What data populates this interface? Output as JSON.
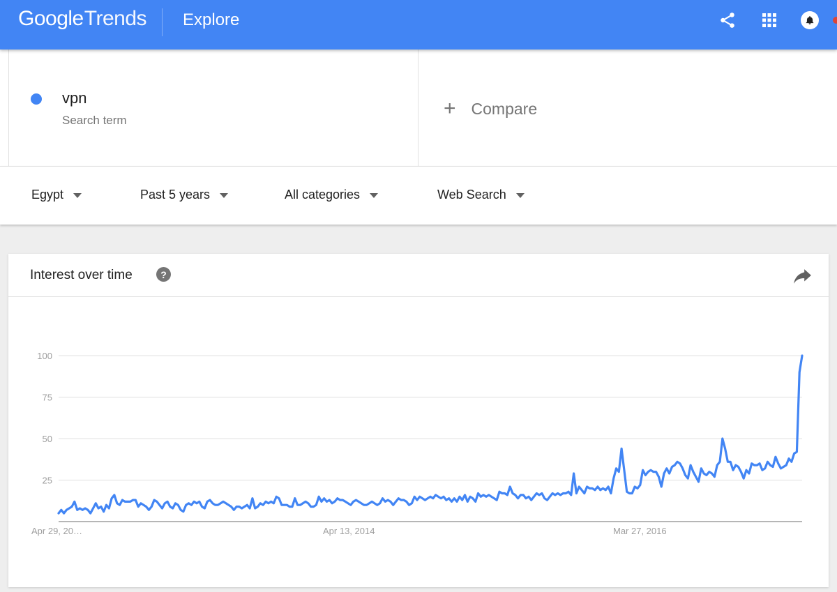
{
  "header": {
    "logo_google": "Google",
    "logo_trends": "Trends",
    "section": "Explore",
    "icons": [
      "share-icon",
      "apps-grid-icon",
      "notifications-icon"
    ],
    "brand_color": "#4285f4"
  },
  "term": {
    "name": "vpn",
    "subtitle": "Search term",
    "color": "#4285f4"
  },
  "compare": {
    "plus": "+",
    "label": "Compare"
  },
  "filters": {
    "region": "Egypt",
    "time": "Past 5 years",
    "category": "All categories",
    "property": "Web Search"
  },
  "card": {
    "title": "Interest over time",
    "help": "?"
  },
  "chart_data": {
    "type": "line",
    "title": "Interest over time",
    "ylim": [
      0,
      100
    ],
    "yticks": [
      25,
      50,
      75,
      100
    ],
    "grid": true,
    "x_tick_labels": [
      "Apr 29, 20…",
      "Apr 13, 2014",
      "Mar 27, 2016"
    ],
    "series": [
      {
        "name": "vpn",
        "color": "#4285f4",
        "values": [
          5,
          7,
          5,
          7,
          8,
          9,
          12,
          7,
          8,
          7,
          8,
          7,
          5,
          8,
          11,
          8,
          9,
          6,
          10,
          8,
          14,
          16,
          11,
          10,
          13,
          12,
          12,
          12,
          13,
          13,
          9,
          11,
          10,
          9,
          7,
          9,
          13,
          12,
          10,
          8,
          11,
          12,
          9,
          8,
          11,
          10,
          7,
          6,
          10,
          11,
          10,
          12,
          11,
          12,
          9,
          8,
          12,
          13,
          11,
          10,
          10,
          11,
          12,
          11,
          10,
          9,
          7,
          9,
          9,
          8,
          9,
          10,
          8,
          14,
          8,
          9,
          11,
          10,
          12,
          11,
          12,
          11,
          15,
          14,
          10,
          10,
          10,
          9,
          9,
          14,
          10,
          10,
          11,
          12,
          11,
          9,
          9,
          10,
          15,
          12,
          14,
          12,
          13,
          11,
          12,
          14,
          13,
          13,
          12,
          11,
          10,
          12,
          13,
          12,
          11,
          10,
          10,
          11,
          12,
          11,
          10,
          11,
          14,
          12,
          13,
          12,
          10,
          12,
          14,
          13,
          13,
          12,
          10,
          11,
          15,
          13,
          15,
          14,
          13,
          14,
          15,
          14,
          16,
          15,
          14,
          15,
          13,
          14,
          12,
          14,
          12,
          15,
          13,
          16,
          12,
          15,
          14,
          12,
          17,
          15,
          16,
          15,
          16,
          15,
          14,
          13,
          18,
          17,
          17,
          16,
          21,
          17,
          16,
          14,
          16,
          16,
          14,
          15,
          13,
          15,
          17,
          16,
          17,
          14,
          13,
          15,
          17,
          16,
          17,
          16,
          17,
          17,
          18,
          16,
          29,
          17,
          21,
          19,
          17,
          21,
          20,
          20,
          19,
          21,
          19,
          20,
          19,
          21,
          17,
          26,
          32,
          30,
          44,
          31,
          18,
          17,
          17,
          21,
          20,
          22,
          31,
          28,
          30,
          31,
          30,
          30,
          27,
          21,
          29,
          32,
          29,
          33,
          34,
          36,
          35,
          32,
          28,
          26,
          34,
          30,
          27,
          24,
          32,
          29,
          28,
          30,
          29,
          27,
          34,
          36,
          50,
          44,
          36,
          36,
          31,
          34,
          33,
          30,
          26,
          31,
          29,
          35,
          34,
          34,
          35,
          31,
          32,
          36,
          34,
          33,
          39,
          35,
          32,
          33,
          34,
          38,
          36,
          41,
          42,
          90,
          100
        ]
      }
    ]
  }
}
